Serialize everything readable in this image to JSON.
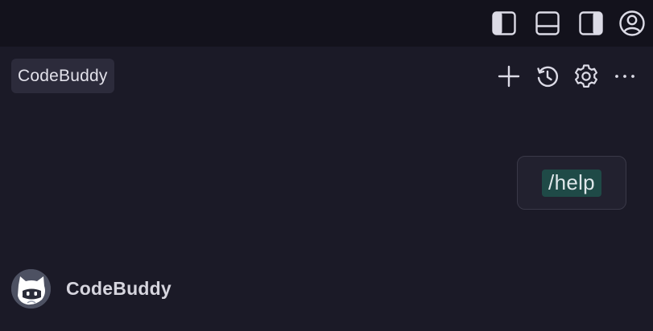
{
  "titlebar": {
    "icons": [
      "toggle-primary-sidebar-icon",
      "toggle-panel-icon",
      "toggle-secondary-sidebar-icon",
      "account-icon"
    ]
  },
  "chat_header": {
    "tab_label": "CodeBuddy",
    "actions": [
      "new-chat-icon",
      "history-icon",
      "settings-icon",
      "more-options-icon"
    ]
  },
  "conversation": {
    "user_message": "/help",
    "assistant_name": "CodeBuddy"
  },
  "colors": {
    "background": "#1b1a27",
    "titlebar": "#13121c",
    "command_chip": "#1f4a47"
  }
}
